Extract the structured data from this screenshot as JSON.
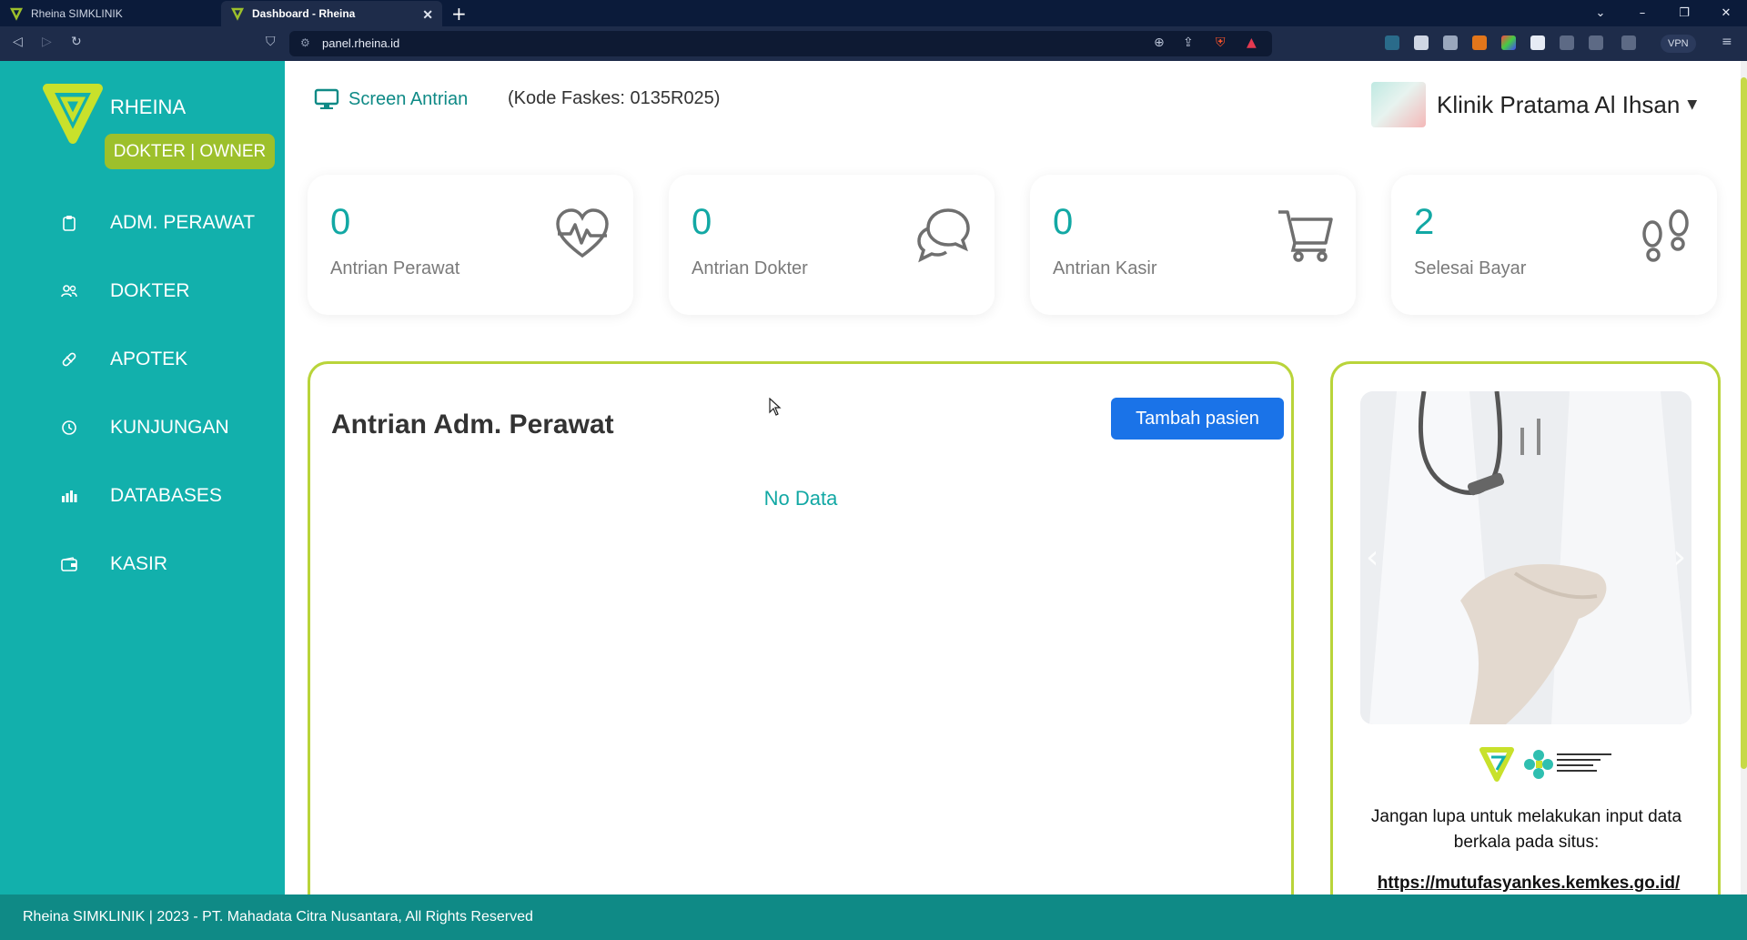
{
  "browser": {
    "tabs": [
      {
        "title": "Rheina SIMKLINIK"
      },
      {
        "title": "Dashboard - Rheina"
      }
    ],
    "url": "panel.rheina.id",
    "vpn_label": "VPN"
  },
  "sidebar": {
    "brand": "RHEINA",
    "role": "DOKTER | OWNER",
    "items": [
      {
        "label": "ADM. PERAWAT",
        "icon": "clipboard-icon"
      },
      {
        "label": "DOKTER",
        "icon": "users-icon"
      },
      {
        "label": "APOTEK",
        "icon": "pill-icon"
      },
      {
        "label": "KUNJUNGAN",
        "icon": "clock-icon"
      },
      {
        "label": "DATABASES",
        "icon": "bar-chart-icon"
      },
      {
        "label": "KASIR",
        "icon": "wallet-icon"
      }
    ]
  },
  "header": {
    "screen_link": "Screen Antrian",
    "faskes": "(Kode Faskes: 0135R025)",
    "clinic_name": "Klinik Pratama Al Ihsan"
  },
  "stats": [
    {
      "value": "0",
      "label": "Antrian Perawat",
      "icon": "heart-pulse-icon"
    },
    {
      "value": "0",
      "label": "Antrian Dokter",
      "icon": "chat-bubbles-icon"
    },
    {
      "value": "0",
      "label": "Antrian Kasir",
      "icon": "cart-icon"
    },
    {
      "value": "2",
      "label": "Selesai Bayar",
      "icon": "footprints-icon"
    }
  ],
  "queue_panel": {
    "title": "Antrian Adm. Perawat",
    "add_button": "Tambah pasien",
    "empty_text": "No Data"
  },
  "side_panel": {
    "reminder": "Jangan lupa untuk melakukan input data berkala pada situs:",
    "link": "https://mutufasyankes.kemkes.go.id/"
  },
  "footer": {
    "text": "Rheina SIMKLINIK | 2023 - PT. Mahadata Citra Nusantara, All Rights Reserved"
  },
  "colors": {
    "sidebar": "#12b0ac",
    "accent": "#12a8a4",
    "badge": "#9dc02b",
    "border": "#b9d43a",
    "button": "#1a73e8",
    "footer": "#0f8a86"
  }
}
